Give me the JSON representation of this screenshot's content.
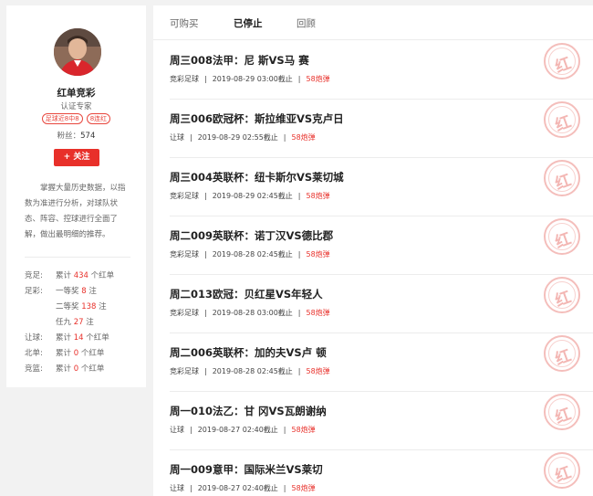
{
  "colors": {
    "accent": "#e8302a",
    "stamp": "#f1aaa6",
    "text": "#222222"
  },
  "profile": {
    "avatar_icon": "avatar-photo",
    "name": "红单竞彩",
    "cert": "认证专家",
    "tags": [
      "足球近8中8",
      "8连红"
    ],
    "fans_label": "粉丝：",
    "fans_value": "574",
    "follow_label": "+ 关注",
    "intro": "掌握大量历史数据，以指数为准进行分析，对球队状态、阵容、控球进行全面了解，做出最明细的推荐。",
    "stats": [
      {
        "label": "竞足:",
        "prefix": "累计 ",
        "value": "434",
        "suffix": " 个红单"
      },
      {
        "label": "足彩:",
        "prefix": "一等奖 ",
        "value": "8",
        "suffix": " 注"
      },
      {
        "label": "",
        "prefix": "二等奖 ",
        "value": "138",
        "suffix": " 注"
      },
      {
        "label": "",
        "prefix": "任九 ",
        "value": "27",
        "suffix": " 注"
      },
      {
        "label": "让球:",
        "prefix": "累计 ",
        "value": "14",
        "suffix": " 个红单"
      },
      {
        "label": "北单:",
        "prefix": "累计 ",
        "value": "0",
        "suffix": " 个红单"
      },
      {
        "label": "竞篮:",
        "prefix": "累计 ",
        "value": "0",
        "suffix": " 个红单"
      }
    ]
  },
  "tabs": [
    "可购买",
    "已停止",
    "回顾"
  ],
  "active_tab": 1,
  "stamp_text": "红",
  "recommendations": [
    {
      "title": "周三008法甲：尼 斯VS马 赛",
      "type": "竞彩足球",
      "deadline": "2019-08-29 03:00截止",
      "price": "58炮弹"
    },
    {
      "title": "周三006欧冠杯：斯拉维亚VS克卢日",
      "type": "让球",
      "deadline": "2019-08-29 02:55截止",
      "price": "58炮弹"
    },
    {
      "title": "周三004英联杯：纽卡斯尔VS莱切城",
      "type": "竞彩足球",
      "deadline": "2019-08-29 02:45截止",
      "price": "58炮弹"
    },
    {
      "title": "周二009英联杯：诺丁汉VS德比郡",
      "type": "竞彩足球",
      "deadline": "2019-08-28 02:45截止",
      "price": "58炮弹"
    },
    {
      "title": "周二013欧冠：贝红星VS年轻人",
      "type": "竞彩足球",
      "deadline": "2019-08-28 03:00截止",
      "price": "58炮弹"
    },
    {
      "title": "周二006英联杯：加的夫VS卢 顿",
      "type": "竞彩足球",
      "deadline": "2019-08-28 02:45截止",
      "price": "58炮弹"
    },
    {
      "title": "周一010法乙：甘 冈VS瓦朗谢纳",
      "type": "让球",
      "deadline": "2019-08-27 02:40截止",
      "price": "58炮弹"
    },
    {
      "title": "周一009意甲：国际米兰VS莱切",
      "type": "让球",
      "deadline": "2019-08-27 02:40截止",
      "price": "58炮弹"
    }
  ]
}
